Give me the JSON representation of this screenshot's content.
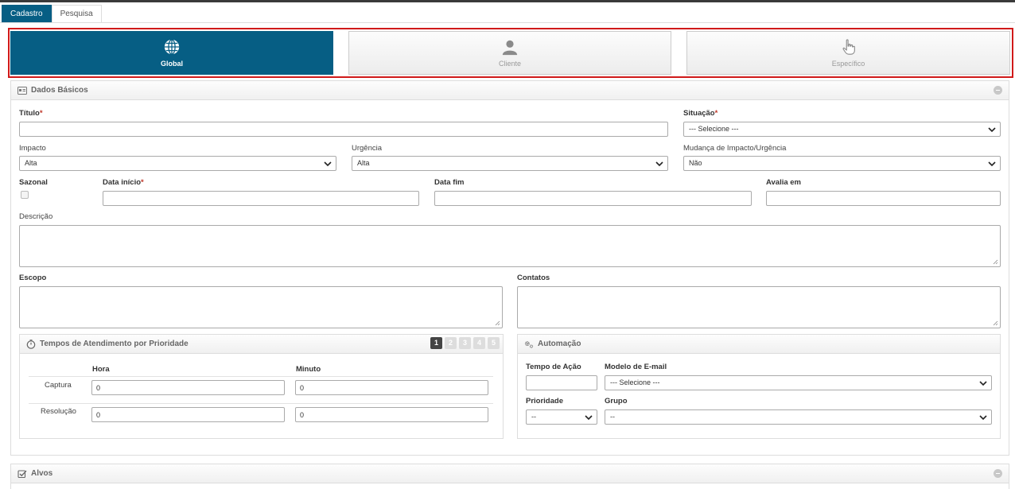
{
  "tabs": [
    {
      "label": "Cadastro",
      "active": true
    },
    {
      "label": "Pesquisa",
      "active": false
    }
  ],
  "type_selector": {
    "global": {
      "label": "Global",
      "icon": "globe-icon"
    },
    "cliente": {
      "label": "Cliente",
      "icon": "user-icon"
    },
    "especifico": {
      "label": "Específico",
      "icon": "hand-pointer-icon"
    }
  },
  "dados_basicos": {
    "title": "Dados Básicos",
    "titulo_label": "Título",
    "titulo_value": "",
    "situacao_label": "Situação",
    "situacao_value": "--- Selecione ---",
    "impacto_label": "Impacto",
    "impacto_value": "Alta",
    "urgencia_label": "Urgência",
    "urgencia_value": "Alta",
    "mudanca_label": "Mudança de Impacto/Urgência",
    "mudanca_value": "Não",
    "sazonal_label": "Sazonal",
    "data_inicio_label": "Data início",
    "data_fim_label": "Data fim",
    "avalia_em_label": "Avalia em",
    "descricao_label": "Descrição",
    "escopo_label": "Escopo",
    "contatos_label": "Contatos",
    "required_mark": "*"
  },
  "tempos": {
    "title": "Tempos de Atendimento por Prioridade",
    "pages": [
      "1",
      "2",
      "3",
      "4",
      "5"
    ],
    "hora_label": "Hora",
    "minuto_label": "Minuto",
    "rows": [
      {
        "label": "Captura",
        "hora": "0",
        "minuto": "0"
      },
      {
        "label": "Resolução",
        "hora": "0",
        "minuto": "0"
      }
    ]
  },
  "automacao": {
    "title": "Automação",
    "tempo_acao_label": "Tempo de Ação",
    "modelo_email_label": "Modelo de E-mail",
    "modelo_email_value": "--- Selecione ---",
    "prioridade_label": "Prioridade",
    "prioridade_value": "--",
    "grupo_label": "Grupo",
    "grupo_value": "--"
  },
  "alvos": {
    "title": "Alvos"
  },
  "colors": {
    "primary": "#065e84",
    "highlight": "#d01a1a"
  }
}
